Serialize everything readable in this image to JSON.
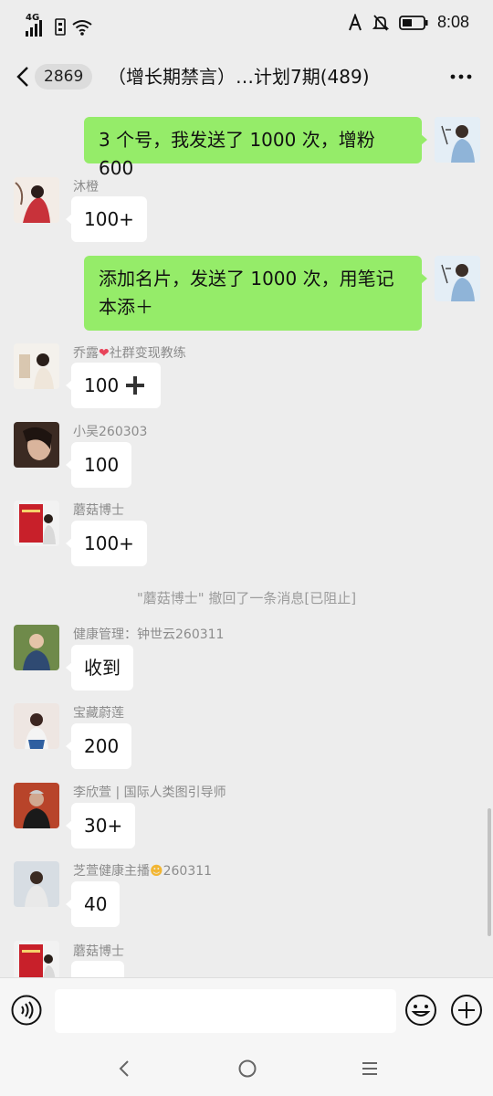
{
  "status_bar": {
    "network": "4G",
    "time": "8:08"
  },
  "nav": {
    "unread_count": "2869",
    "title": "（增长期禁言）…计划7期(489)"
  },
  "messages": [
    {
      "from": "self",
      "text": "3 个号，我发送了 1000 次，增粉 600"
    },
    {
      "sender": "沐橙",
      "text": "100+"
    },
    {
      "from": "self",
      "text": "添加名片，发送了 1000 次，用笔记本添＋"
    },
    {
      "sender": "乔露",
      "sender_suffix": "社群变现教练",
      "text": "100"
    },
    {
      "sender": "小吴260303",
      "text": "100"
    },
    {
      "sender": "蘑菇博士",
      "text": "100+"
    },
    {
      "system": "\"蘑菇博士\" 撤回了一条消息[已阻止]"
    },
    {
      "sender": "健康管理：钟世云260311",
      "text": "收到"
    },
    {
      "sender": "宝藏蔚莲",
      "text": "200"
    },
    {
      "sender": "李欣萱 | 国际人类图引导师",
      "text": "30+"
    },
    {
      "sender": "芝萱健康主播",
      "sender_suffix": "260311",
      "text": "40"
    },
    {
      "sender": "蘑菇博士",
      "text": ""
    }
  ],
  "icons": {
    "heart": "heart-icon",
    "smile": "smile-emoji-icon",
    "plus": "plus-icon"
  },
  "colors": {
    "self_bubble": "#95ec69",
    "other_bubble": "#ffffff",
    "background": "#ededed"
  }
}
